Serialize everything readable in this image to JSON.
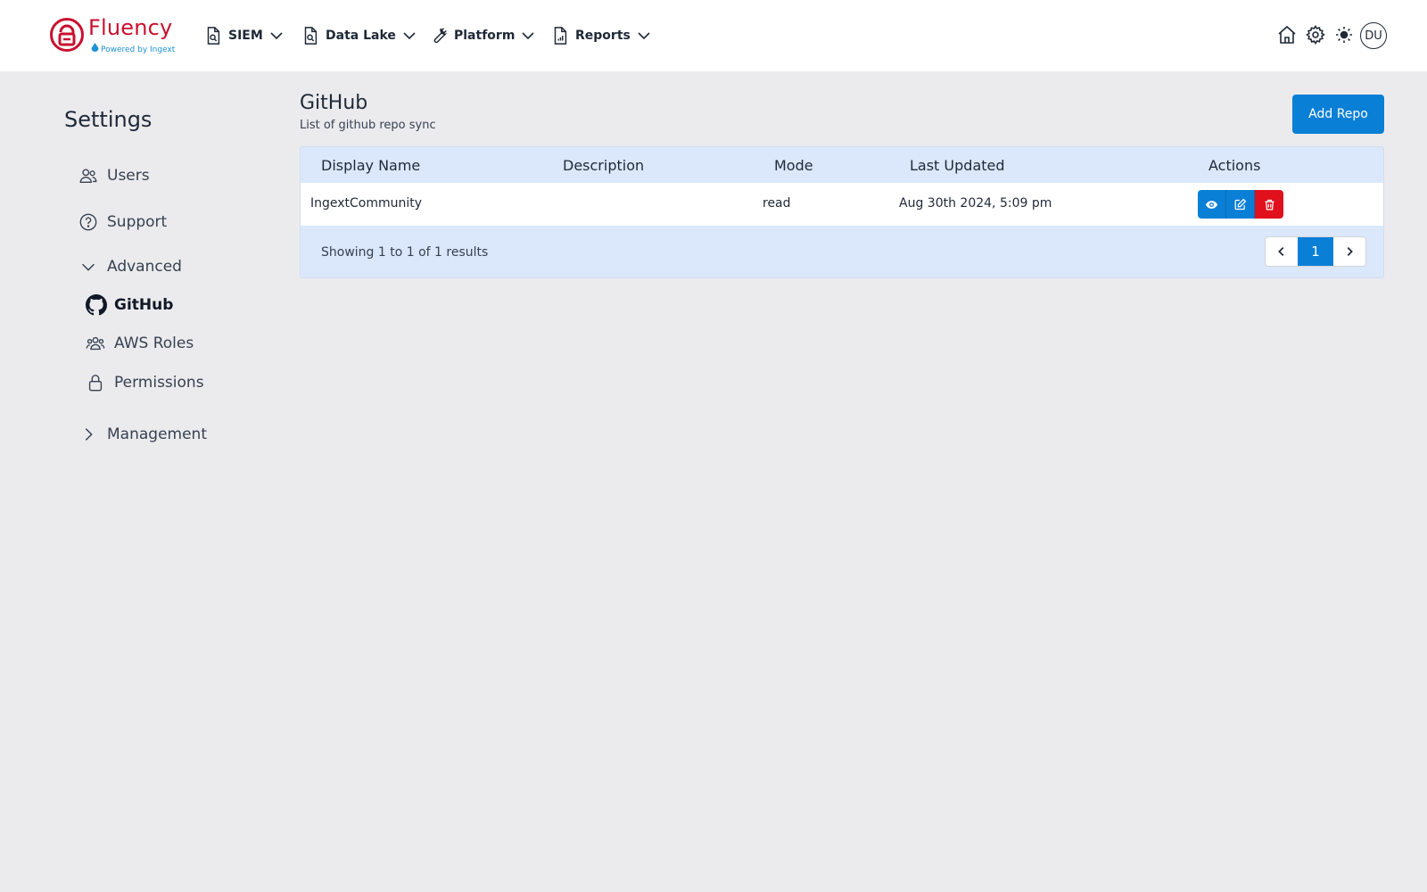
{
  "brand": {
    "name": "Fluency",
    "tagline": "Powered by Ingext",
    "color": "#c8102e",
    "accent": "#1e90d6"
  },
  "nav": {
    "items": [
      {
        "label": "SIEM",
        "icon": "document-search-icon"
      },
      {
        "label": "Data Lake",
        "icon": "document-search-icon"
      },
      {
        "label": "Platform",
        "icon": "wrench-icon"
      },
      {
        "label": "Reports",
        "icon": "document-chart-icon"
      }
    ],
    "right_icons": [
      "home-icon",
      "gear-icon",
      "sun-icon"
    ],
    "avatar_initials": "DU"
  },
  "sidebar": {
    "title": "Settings",
    "items": [
      {
        "label": "Users",
        "icon": "users-icon"
      },
      {
        "label": "Support",
        "icon": "question-circle-icon"
      },
      {
        "label": "Advanced",
        "icon": "chevron-down-icon",
        "expanded": true
      },
      {
        "label": "GitHub",
        "icon": "github-icon",
        "active": true
      },
      {
        "label": "AWS Roles",
        "icon": "user-group-icon"
      },
      {
        "label": "Permissions",
        "icon": "lock-icon"
      },
      {
        "label": "Management",
        "icon": "chevron-right-icon",
        "expanded": false
      }
    ]
  },
  "main": {
    "title": "GitHub",
    "subtitle": "List of github repo sync",
    "add_button": "Add Repo",
    "table": {
      "columns": [
        "Display Name",
        "Description",
        "Mode",
        "Last Updated",
        "Actions"
      ],
      "rows": [
        {
          "display_name": "IngextCommunity",
          "description": "",
          "mode": "read",
          "last_updated": "Aug 30th 2024, 5:09 pm",
          "actions": [
            "eye-icon",
            "edit-icon",
            "trash-icon"
          ]
        }
      ],
      "footer": "Showing 1 to 1 of 1 results"
    },
    "pagination": {
      "current": "1"
    }
  },
  "colors": {
    "primary": "#0a7fd6",
    "danger": "#e0101d",
    "table_header_bg": "#dbe8fb",
    "page_bg": "#ebebee"
  }
}
